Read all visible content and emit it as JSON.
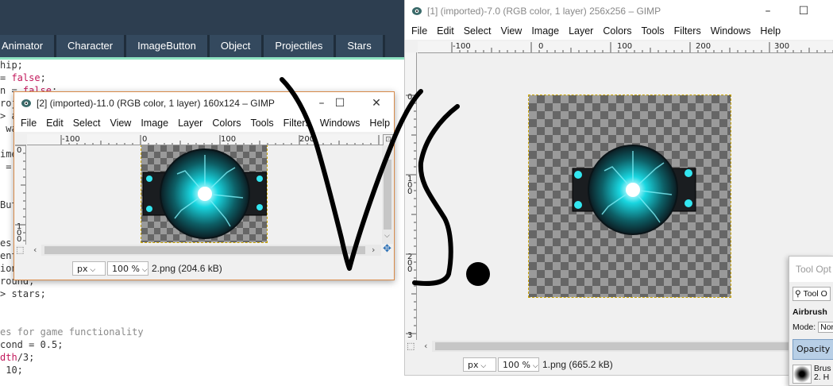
{
  "editor": {
    "tabs": [
      "Animator",
      "Character",
      "ImageButton",
      "Object",
      "Projectiles",
      "Stars"
    ],
    "lines": [
      {
        "parts": [
          {
            "t": "hip;",
            "c": ""
          }
        ]
      },
      {
        "parts": [
          {
            "t": "= ",
            "c": ""
          },
          {
            "t": "false",
            "c": "kw"
          },
          {
            "t": ";",
            "c": ""
          }
        ]
      },
      {
        "parts": [
          {
            "t": "n = ",
            "c": ""
          },
          {
            "t": "false",
            "c": "kw"
          },
          {
            "t": ";",
            "c": ""
          }
        ]
      },
      {
        "parts": [
          {
            "t": "roj",
            "c": ""
          }
        ]
      },
      {
        "parts": [
          {
            "t": "> a",
            "c": ""
          }
        ]
      },
      {
        "parts": [
          {
            "t": " wa",
            "c": ""
          }
        ]
      },
      {
        "parts": [
          {
            "t": "",
            "c": ""
          }
        ]
      },
      {
        "parts": [
          {
            "t": "ime",
            "c": ""
          }
        ]
      },
      {
        "parts": [
          {
            "t": " =",
            "c": ""
          }
        ]
      },
      {
        "parts": [
          {
            "t": "",
            "c": ""
          }
        ]
      },
      {
        "parts": [
          {
            "t": "",
            "c": ""
          }
        ]
      },
      {
        "parts": [
          {
            "t": "But",
            "c": ""
          }
        ]
      },
      {
        "parts": [
          {
            "t": "",
            "c": ""
          }
        ]
      },
      {
        "parts": [
          {
            "t": "",
            "c": ""
          }
        ]
      },
      {
        "parts": [
          {
            "t": "es",
            "c": ""
          }
        ]
      },
      {
        "parts": [
          {
            "t": "ent;",
            "c": ""
          }
        ]
      },
      {
        "parts": [
          {
            "t": "ion",
            "c": ""
          }
        ]
      },
      {
        "parts": [
          {
            "t": "round;",
            "c": ""
          }
        ]
      },
      {
        "parts": [
          {
            "t": "> stars;",
            "c": ""
          }
        ]
      },
      {
        "parts": [
          {
            "t": "",
            "c": ""
          }
        ]
      },
      {
        "parts": [
          {
            "t": "",
            "c": ""
          }
        ]
      },
      {
        "parts": [
          {
            "t": "es for game functionality",
            "c": "cm"
          }
        ]
      },
      {
        "parts": [
          {
            "t": "cond = 0.5;",
            "c": ""
          }
        ]
      },
      {
        "parts": [
          {
            "t": "dth",
            "c": "kw"
          },
          {
            "t": "/3;",
            "c": ""
          }
        ]
      },
      {
        "parts": [
          {
            "t": " 10;",
            "c": ""
          }
        ]
      }
    ]
  },
  "gimp_small": {
    "title": "[2] (imported)-11.0 (RGB color, 1 layer) 160x124 – GIMP",
    "menu": [
      "File",
      "Edit",
      "Select",
      "View",
      "Image",
      "Layer",
      "Colors",
      "Tools",
      "Filters",
      "Windows",
      "Help"
    ],
    "ruler_h": [
      "-100",
      "0",
      "100",
      "200"
    ],
    "ruler_v": [
      "0",
      "1\n0\n0"
    ],
    "unit": "px",
    "zoom": "100 %",
    "status": "2.png (204.6 kB)"
  },
  "gimp_large": {
    "title": "[1] (imported)-7.0 (RGB color, 1 layer) 256x256 – GIMP",
    "menu": [
      "File",
      "Edit",
      "Select",
      "View",
      "Image",
      "Layer",
      "Colors",
      "Tools",
      "Filters",
      "Windows",
      "Help"
    ],
    "ruler_h": [
      "-100",
      "0",
      "100",
      "200",
      "300"
    ],
    "ruler_v": [
      "0",
      "1\n0\n0",
      "2\n0\n0",
      "3"
    ],
    "unit": "px",
    "zoom": "100 %",
    "status": "1.png (665.2 kB)"
  },
  "tool_options": {
    "title": "Tool Opt",
    "row1": "Tool O",
    "tool": "Airbrush",
    "mode_label": "Mode:",
    "mode_value": "Norr",
    "opacity_label": "Opacity",
    "brush_label": "Brus",
    "brush_value": "2. H"
  },
  "colors": {
    "editor_dark": "#2d3e50",
    "accent_line": "#8ee3c2",
    "orb_cyan": "#19d6e0",
    "selection_dash": "#caa400"
  },
  "window_controls": {
    "minimize": "–",
    "maximize": "☐",
    "close": "✕"
  }
}
